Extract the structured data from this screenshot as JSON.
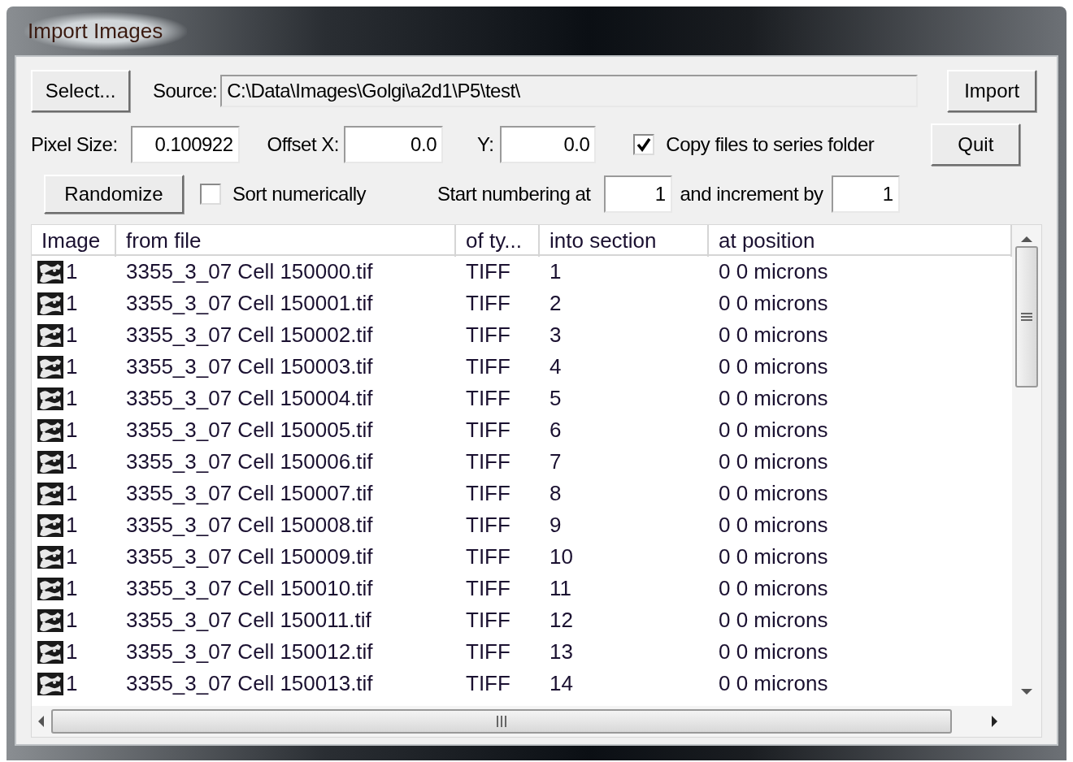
{
  "window": {
    "title": "Import Images"
  },
  "select_button": "Select...",
  "source": {
    "label": "Source:",
    "value": "C:\\Data\\Images\\Golgi\\a2d1\\P5\\test\\"
  },
  "import_button": "Import",
  "quit_button": "Quit",
  "pixel_size": {
    "label": "Pixel Size:",
    "value": "0.100922"
  },
  "offset_x": {
    "label": "Offset X:",
    "value": "0.0"
  },
  "offset_y": {
    "label": "Y:",
    "value": "0.0"
  },
  "copy_files": {
    "label": "Copy files to series folder",
    "checked": true
  },
  "randomize_button": "Randomize",
  "sort_numerically": {
    "label": "Sort numerically",
    "checked": false
  },
  "start_numbering": {
    "label": "Start numbering at",
    "value": "1"
  },
  "increment": {
    "label": "and increment by",
    "value": "1"
  },
  "table": {
    "columns": [
      "Image",
      "from file",
      "of ty...",
      "into section",
      "at position"
    ],
    "rows": [
      {
        "image": "1",
        "file": "3355_3_07 Cell 150000.tif",
        "type": "TIFF",
        "section": "1",
        "position": "0 0 microns"
      },
      {
        "image": "1",
        "file": "3355_3_07 Cell 150001.tif",
        "type": "TIFF",
        "section": "2",
        "position": "0 0 microns"
      },
      {
        "image": "1",
        "file": "3355_3_07 Cell 150002.tif",
        "type": "TIFF",
        "section": "3",
        "position": "0 0 microns"
      },
      {
        "image": "1",
        "file": "3355_3_07 Cell 150003.tif",
        "type": "TIFF",
        "section": "4",
        "position": "0 0 microns"
      },
      {
        "image": "1",
        "file": "3355_3_07 Cell 150004.tif",
        "type": "TIFF",
        "section": "5",
        "position": "0 0 microns"
      },
      {
        "image": "1",
        "file": "3355_3_07 Cell 150005.tif",
        "type": "TIFF",
        "section": "6",
        "position": "0 0 microns"
      },
      {
        "image": "1",
        "file": "3355_3_07 Cell 150006.tif",
        "type": "TIFF",
        "section": "7",
        "position": "0 0 microns"
      },
      {
        "image": "1",
        "file": "3355_3_07 Cell 150007.tif",
        "type": "TIFF",
        "section": "8",
        "position": "0 0 microns"
      },
      {
        "image": "1",
        "file": "3355_3_07 Cell 150008.tif",
        "type": "TIFF",
        "section": "9",
        "position": "0 0 microns"
      },
      {
        "image": "1",
        "file": "3355_3_07 Cell 150009.tif",
        "type": "TIFF",
        "section": "10",
        "position": "0 0 microns"
      },
      {
        "image": "1",
        "file": "3355_3_07 Cell 150010.tif",
        "type": "TIFF",
        "section": "11",
        "position": "0 0 microns"
      },
      {
        "image": "1",
        "file": "3355_3_07 Cell 150011.tif",
        "type": "TIFF",
        "section": "12",
        "position": "0 0 microns"
      },
      {
        "image": "1",
        "file": "3355_3_07 Cell 150012.tif",
        "type": "TIFF",
        "section": "13",
        "position": "0 0 microns"
      },
      {
        "image": "1",
        "file": "3355_3_07 Cell 150013.tif",
        "type": "TIFF",
        "section": "14",
        "position": "0 0 microns"
      }
    ]
  }
}
